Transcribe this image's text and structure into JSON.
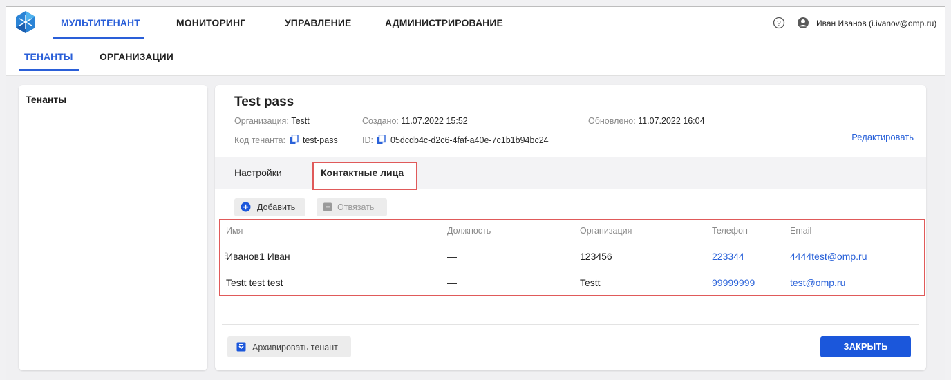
{
  "topbar": {
    "nav": [
      "МУЛЬТИТЕНАНТ",
      "МОНИТОРИНГ",
      "УПРАВЛЕНИЕ",
      "АДМИНИСТРИРОВАНИЕ"
    ],
    "active_nav": "МУЛЬТИТЕНАНТ",
    "user": "Иван Иванов (i.ivanov@omp.ru)",
    "icons": [
      "logo-icon",
      "help-icon",
      "user-icon"
    ]
  },
  "subnav": {
    "tabs": [
      "ТЕНАНТЫ",
      "ОРГАНИЗАЦИИ"
    ],
    "active": "ТЕНАНТЫ"
  },
  "left_panel": {
    "title": "Тенанты"
  },
  "tenant": {
    "title": "Test pass",
    "org_label": "Организация:",
    "org_value": "Testt",
    "created_label": "Создано:",
    "created_value": "11.07.2022 15:52",
    "updated_label": "Обновлено:",
    "updated_value": "11.07.2022 16:04",
    "code_label": "Код тенанта:",
    "code_value": "test-pass",
    "id_label": "ID:",
    "id_value": "05dcdb4c-d2c6-4faf-a40e-7c1b1b94bc24",
    "edit_label": "Редактировать"
  },
  "tabs": {
    "settings": "Настройки",
    "contacts": "Контактные лица",
    "active": "Контактные лица"
  },
  "toolbar": {
    "add_label": "Добавить",
    "unlink_label": "Отвязать"
  },
  "table": {
    "headers": [
      "Имя",
      "Должность",
      "Организация",
      "Телефон",
      "Email"
    ],
    "rows": [
      [
        "Иванов1 Иван",
        "—",
        "123456",
        "223344",
        "4444test@omp.ru"
      ],
      [
        "Testt test test",
        "—",
        "Testt",
        "99999999",
        "test@omp.ru"
      ]
    ]
  },
  "footer": {
    "archive_label": "Архивировать тенант",
    "close_label": "ЗАКРЫТЬ"
  },
  "colors": {
    "accent": "#2a5fd8",
    "primary_button": "#1b57db",
    "highlight": "#e05a5a",
    "link": "#2a62d9"
  }
}
